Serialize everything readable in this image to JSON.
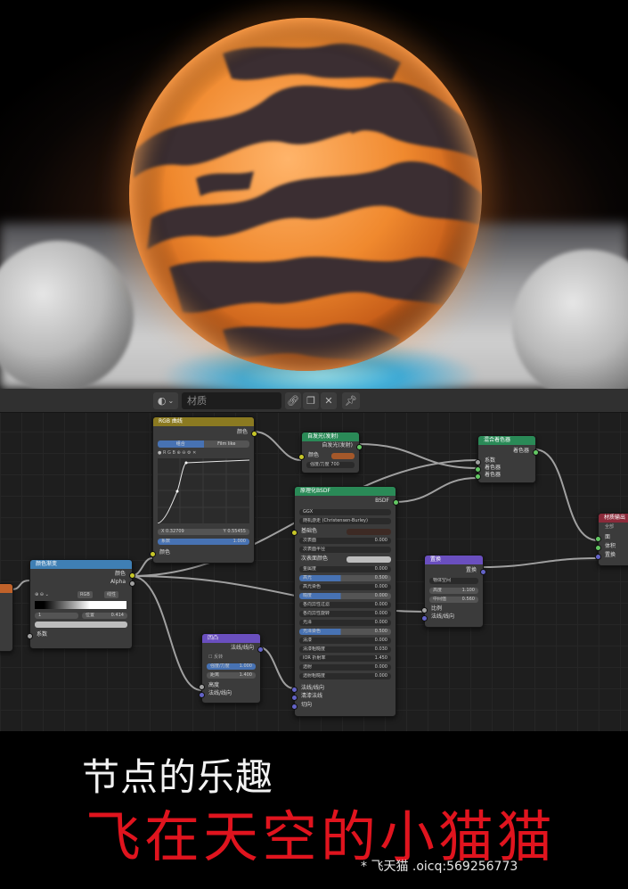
{
  "header": {
    "material_placeholder": "材质"
  },
  "nodes": {
    "rgb_curves": {
      "title": "RGB 曲线",
      "out_color": "颜色",
      "tab_combined": "组合",
      "tab_film": "Film like",
      "x_coord": "X 0.32709",
      "y_coord": "Y 0.55455",
      "factor_label": "系数",
      "factor_value": "1.000",
      "in_color": "颜色"
    },
    "color_ramp": {
      "title": "颜色渐变",
      "out_color": "颜色",
      "out_alpha": "Alpha",
      "mode": "RGB",
      "interp": "线性",
      "stop_index": "1",
      "pos_label": "位置",
      "pos_value": "0.414",
      "in_factor": "系数"
    },
    "emission": {
      "title": "自发光(发射)",
      "out": "自发光(发射)",
      "in_color": "颜色",
      "strength": "强度/力度 700"
    },
    "mix_shader": {
      "title": "混合着色器",
      "out": "着色器",
      "in_fac": "系数",
      "in_shader1": "着色器",
      "in_shader2": "着色器"
    },
    "principled": {
      "title": "原理化BSDF",
      "out": "BSDF",
      "dist": "GGX",
      "sss_method": "随机游走 (Christensen-Burley)",
      "base_color": "基础色",
      "subsurface": "次表面",
      "subsurface_val": "0.000",
      "sss_radius": "次表面半径",
      "sss_color": "次表面颜色",
      "metallic": "金属度",
      "metallic_val": "0.000",
      "specular": "高光",
      "specular_val": "0.500",
      "spec_tint": "高光染色",
      "spec_tint_val": "0.000",
      "roughness": "糙度",
      "roughness_val": "0.000",
      "aniso": "各向异性过滤",
      "aniso_val": "0.000",
      "aniso_rot": "各向异性旋转",
      "aniso_rot_val": "0.000",
      "sheen": "光泽",
      "sheen_val": "0.000",
      "sheen_tint": "光泽染色",
      "sheen_tint_val": "0.500",
      "clearcoat": "清漆",
      "clearcoat_val": "0.000",
      "cc_rough": "清漆粗糙度",
      "cc_rough_val": "0.030",
      "ior": "IOR 折射率",
      "ior_val": "1.450",
      "transmission": "透射",
      "transmission_val": "0.000",
      "trans_rough": "透射粗糙度",
      "trans_rough_val": "0.000",
      "normal": "法线/线向",
      "cc_normal": "清漆法线",
      "tangent": "切向"
    },
    "bump": {
      "title": "凹凸",
      "out": "法线/线向",
      "invert": "反转",
      "strength_label": "强度/力度",
      "strength_val": "1.000",
      "dist_label": "距离",
      "dist_val": "1.400",
      "in_height": "高度",
      "in_normal": "法线/线向"
    },
    "displacement": {
      "title": "置换",
      "out": "置换",
      "space": "物体空间",
      "height_label": "高度",
      "height_val": "1.100",
      "mid_label": "中间值",
      "mid_val": "0.560",
      "scale": "比例",
      "normal": "法线/线向"
    },
    "output": {
      "title": "材质输出",
      "target": "全部",
      "surface": "面",
      "volume": "体积",
      "displacement": "置换"
    }
  },
  "footer": {
    "title": "节点的乐趣",
    "subtitle": "飞在天空的小猫猫",
    "credit": "* 飞天猫 .oicq:569256773"
  },
  "colors": {
    "accent_red": "#e0141e",
    "node_header_shader": "#2a8a57",
    "node_header_color": "#8b7a21",
    "node_header_converter": "#3f7fb4",
    "node_header_vector": "#6a4fbf",
    "node_header_output": "#8b2a3a"
  }
}
